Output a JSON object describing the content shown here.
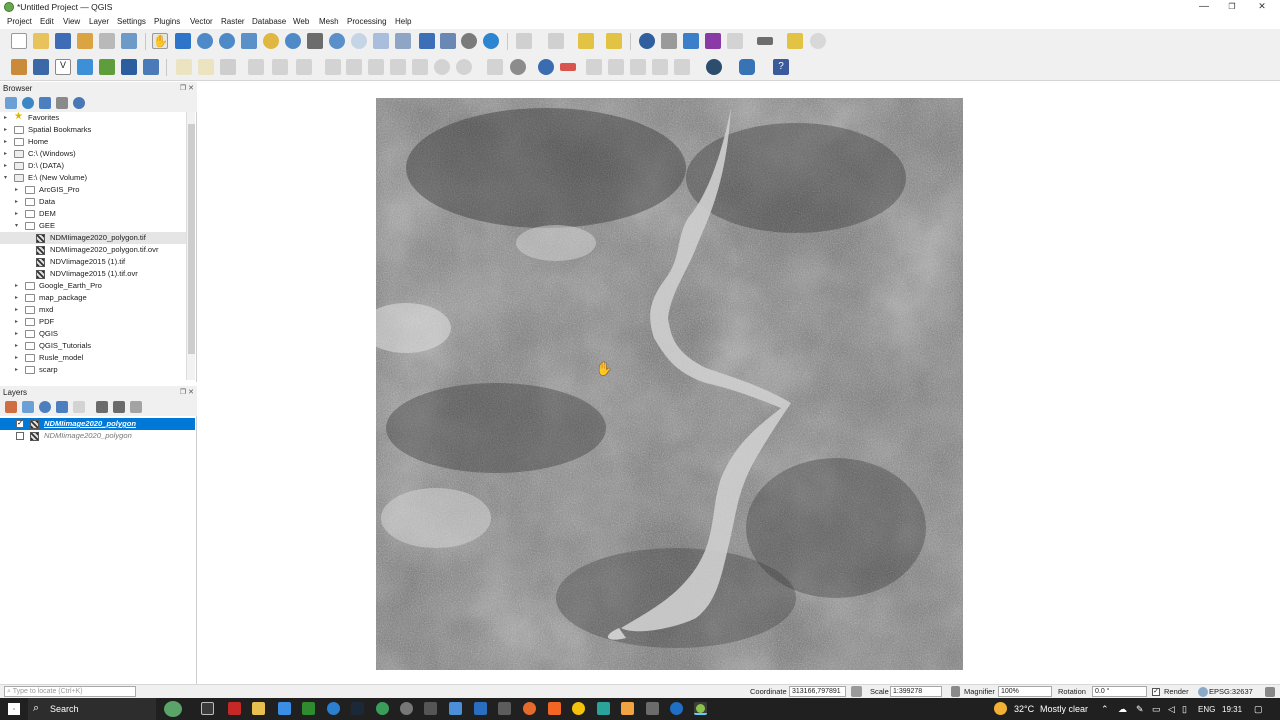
{
  "window": {
    "title": "*Untitled Project — QGIS",
    "controls": {
      "minimize": "—",
      "restore": "❐",
      "close": "✕"
    }
  },
  "menu": [
    "Project",
    "Edit",
    "View",
    "Layer",
    "Settings",
    "Plugins",
    "Vector",
    "Raster",
    "Database",
    "Web",
    "Mesh",
    "Processing",
    "Help"
  ],
  "browser": {
    "title": "Browser",
    "items": [
      {
        "label": "Favorites",
        "icon": "star-icon",
        "level": 0,
        "expander": "▸"
      },
      {
        "label": "Spatial Bookmarks",
        "icon": "bookmark-icon",
        "level": 0,
        "expander": "▸"
      },
      {
        "label": "Home",
        "icon": "folder-icon",
        "level": 0,
        "expander": "▸"
      },
      {
        "label": "C:\\ (Windows)",
        "icon": "drive-icon",
        "level": 0,
        "expander": "▸"
      },
      {
        "label": "D:\\ (DATA)",
        "icon": "drive-icon",
        "level": 0,
        "expander": "▸"
      },
      {
        "label": "E:\\ (New Volume)",
        "icon": "drive-icon",
        "level": 0,
        "expander": "▾"
      },
      {
        "label": "ArcGIS_Pro",
        "icon": "folder-icon",
        "level": 1,
        "expander": "▸"
      },
      {
        "label": "Data",
        "icon": "folder-icon",
        "level": 1,
        "expander": "▸"
      },
      {
        "label": "DEM",
        "icon": "folder-icon",
        "level": 1,
        "expander": "▸"
      },
      {
        "label": "GEE",
        "icon": "folder-icon",
        "level": 1,
        "expander": "▾"
      },
      {
        "label": "NDMIimage2020_polygon.tif",
        "icon": "raster-icon",
        "level": 2,
        "expander": ""
      },
      {
        "label": "NDMIimage2020_polygon.tif.ovr",
        "icon": "raster-icon",
        "level": 2,
        "expander": ""
      },
      {
        "label": "NDVIimage2015 (1).tif",
        "icon": "raster-icon",
        "level": 2,
        "expander": ""
      },
      {
        "label": "NDVIimage2015 (1).tif.ovr",
        "icon": "raster-icon",
        "level": 2,
        "expander": ""
      },
      {
        "label": "Google_Earth_Pro",
        "icon": "folder-icon",
        "level": 1,
        "expander": "▸"
      },
      {
        "label": "map_package",
        "icon": "folder-icon",
        "level": 1,
        "expander": "▸"
      },
      {
        "label": "mxd",
        "icon": "folder-icon",
        "level": 1,
        "expander": "▸"
      },
      {
        "label": "PDF",
        "icon": "folder-icon",
        "level": 1,
        "expander": "▸"
      },
      {
        "label": "QGIS",
        "icon": "folder-icon",
        "level": 1,
        "expander": "▸"
      },
      {
        "label": "QGIS_Tutorials",
        "icon": "folder-icon",
        "level": 1,
        "expander": "▸"
      },
      {
        "label": "Rusle_model",
        "icon": "folder-icon",
        "level": 1,
        "expander": "▸"
      },
      {
        "label": "scarp",
        "icon": "folder-icon",
        "level": 1,
        "expander": "▸"
      }
    ]
  },
  "layers": {
    "title": "Layers",
    "items": [
      {
        "label": "NDMIimage2020_polygon",
        "checked": true,
        "selected": true
      },
      {
        "label": "NDMIimage2020_polygon",
        "checked": false,
        "selected": false
      }
    ]
  },
  "status": {
    "locator_placeholder": "Type to locate (Ctrl+K)",
    "coordinate_label": "Coordinate",
    "coordinate_value": "313166,797891",
    "scale_label": "Scale",
    "scale_value": "1:399278",
    "magnifier_label": "Magnifier",
    "magnifier_value": "100%",
    "rotation_label": "Rotation",
    "rotation_value": "0.0 °",
    "render_label": "Render",
    "crs": "EPSG:32637"
  },
  "taskbar": {
    "search": "Search",
    "weather_temp": "32°C",
    "weather_text": "Mostly clear",
    "lang": "ENG",
    "time": "19:31"
  },
  "colors": {
    "accent": "#0078d7",
    "selection": "#0078d7",
    "taskbar": "#202020"
  }
}
